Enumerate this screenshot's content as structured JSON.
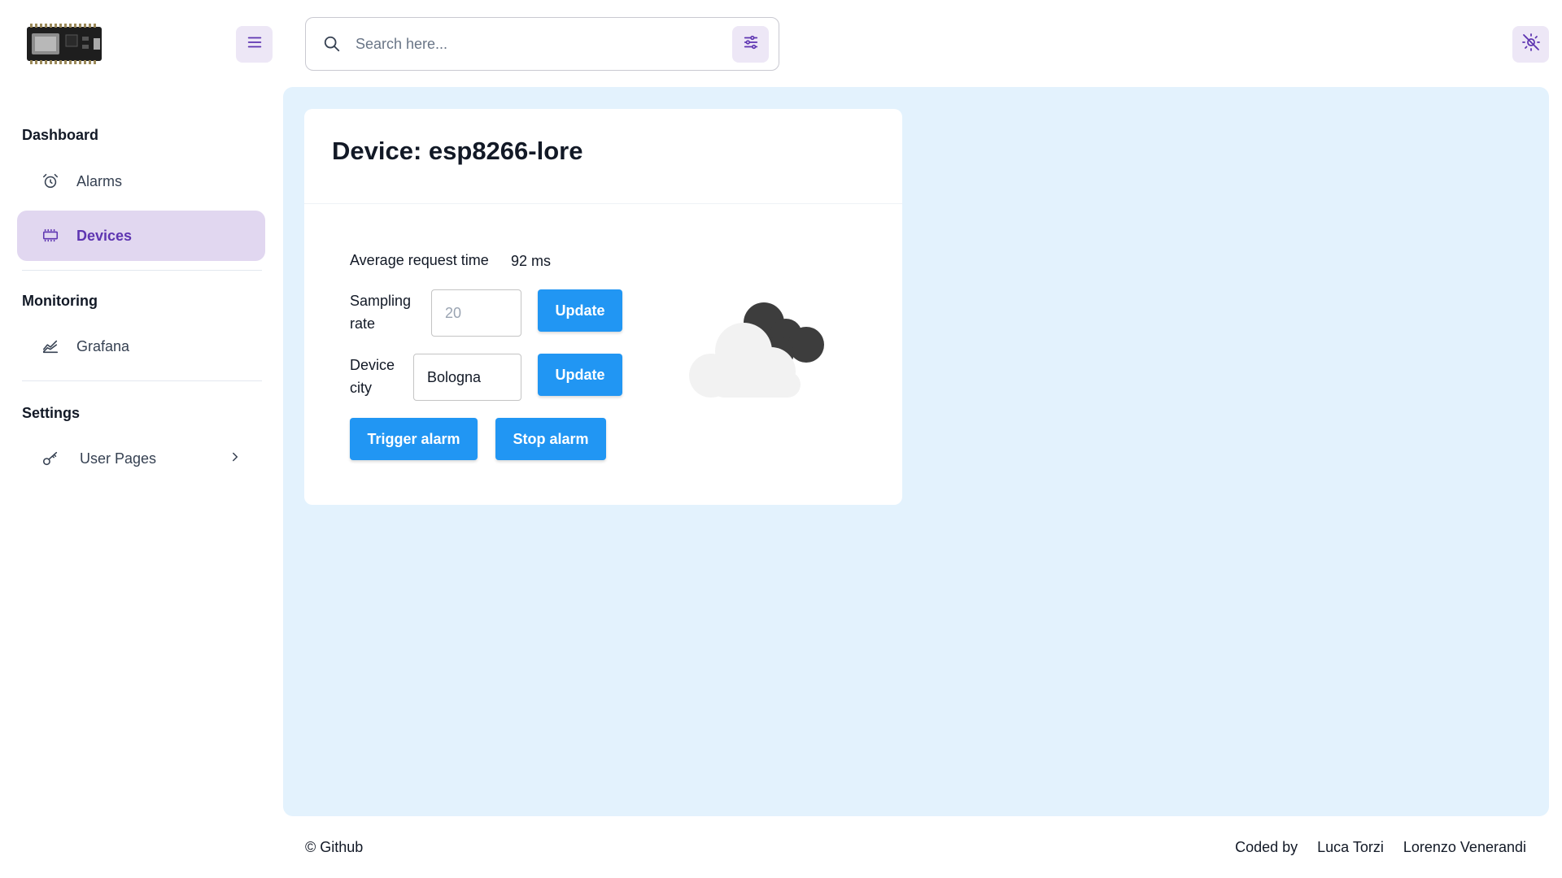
{
  "header": {
    "search_placeholder": "Search here..."
  },
  "sidebar": {
    "sections": [
      {
        "title": "Dashboard",
        "items": [
          {
            "label": "Alarms",
            "icon": "alarm-clock-icon"
          },
          {
            "label": "Devices",
            "icon": "device-icon",
            "active": true
          }
        ]
      },
      {
        "title": "Monitoring",
        "items": [
          {
            "label": "Grafana",
            "icon": "chart-area-icon"
          }
        ]
      },
      {
        "title": "Settings",
        "items": [
          {
            "label": "User Pages",
            "icon": "key-icon",
            "expandable": true
          }
        ]
      }
    ]
  },
  "device": {
    "title": "Device: esp8266-lore",
    "avg_request_label": "Average request time",
    "avg_request_value": "92 ms",
    "sampling_label_line1": "Sampling",
    "sampling_label_line2": "rate",
    "sampling_placeholder": "20",
    "city_label_line1": "Device",
    "city_label_line2": "city",
    "city_value": "Bologna",
    "update_label": "Update",
    "trigger_alarm_label": "Trigger alarm",
    "stop_alarm_label": "Stop alarm",
    "weather_icon": "cloudy-night-icon"
  },
  "footer": {
    "left": "© Github",
    "coded_by": "Coded by",
    "author1": "Luca Torzi",
    "author2": "Lorenzo Venerandi"
  },
  "colors": {
    "accent": "#5e35b1",
    "accent_light": "#ede7f6",
    "primary_button": "#2196f3",
    "main_bg": "#e3f2fd"
  }
}
